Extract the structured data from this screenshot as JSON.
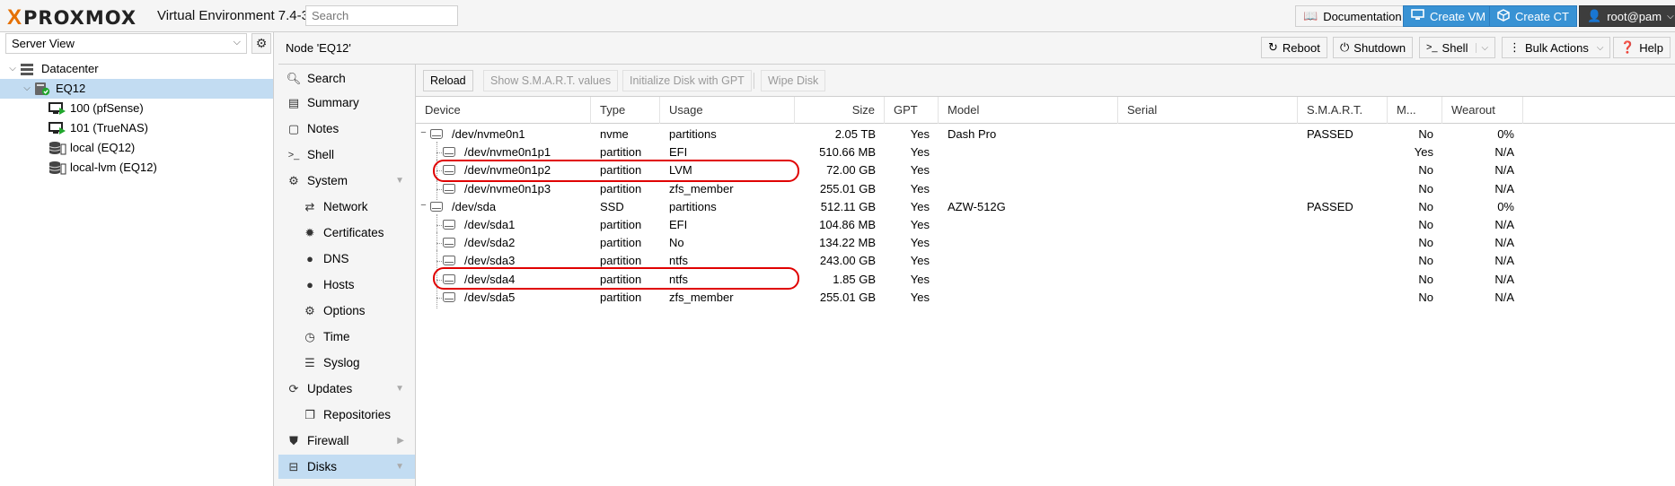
{
  "header": {
    "brand": "PROXMOX",
    "brand_x": "X",
    "version": "Virtual Environment 7.4-3",
    "search_placeholder": "Search",
    "documentation_label": "Documentation",
    "create_vm_label": "Create VM",
    "create_ct_label": "Create CT",
    "user_label": "root@pam"
  },
  "left_panel": {
    "view_select": "Server View",
    "tree": [
      {
        "label": "Datacenter",
        "icon": "datacenter-icon"
      },
      {
        "label": "EQ12",
        "icon": "node-online-icon",
        "selected": true
      },
      {
        "label": "100 (pfSense)",
        "icon": "vm-running-icon"
      },
      {
        "label": "101 (TrueNAS)",
        "icon": "vm-running-icon"
      },
      {
        "label": "local (EQ12)",
        "icon": "storage-icon"
      },
      {
        "label": "local-lvm (EQ12)",
        "icon": "storage-icon"
      }
    ]
  },
  "node_header": {
    "title": "Node 'EQ12'",
    "reboot_label": "Reboot",
    "shutdown_label": "Shutdown",
    "shell_label": "Shell",
    "bulk_actions_label": "Bulk Actions",
    "help_label": "Help"
  },
  "nav": {
    "items": [
      {
        "label": "Search",
        "icon": "search-icon"
      },
      {
        "label": "Summary",
        "icon": "book-icon"
      },
      {
        "label": "Notes",
        "icon": "notes-icon"
      },
      {
        "label": "Shell",
        "icon": "terminal-icon"
      },
      {
        "label": "System",
        "icon": "cogs-icon"
      },
      {
        "label": "Network",
        "icon": "exchange-icon"
      },
      {
        "label": "Certificates",
        "icon": "certificate-icon"
      },
      {
        "label": "DNS",
        "icon": "globe-icon"
      },
      {
        "label": "Hosts",
        "icon": "globe-icon"
      },
      {
        "label": "Options",
        "icon": "gear-icon"
      },
      {
        "label": "Time",
        "icon": "clock-icon"
      },
      {
        "label": "Syslog",
        "icon": "list-icon"
      },
      {
        "label": "Updates",
        "icon": "refresh-icon"
      },
      {
        "label": "Repositories",
        "icon": "files-icon"
      },
      {
        "label": "Firewall",
        "icon": "shield-icon"
      },
      {
        "label": "Disks",
        "icon": "hdd-icon"
      }
    ]
  },
  "toolbar": {
    "reload_label": "Reload",
    "smart_label": "Show S.M.A.R.T. values",
    "init_gpt_label": "Initialize Disk with GPT",
    "wipe_label": "Wipe Disk"
  },
  "disks": {
    "columns": [
      "Device",
      "Type",
      "Usage",
      "Size",
      "GPT",
      "Model",
      "Serial",
      "S.M.A.R.T.",
      "M...",
      "Wearout"
    ],
    "rows": [
      {
        "device": "/dev/nvme0n1",
        "type": "nvme",
        "usage": "partitions",
        "size": "2.05 TB",
        "gpt": "Yes",
        "model": "Dash Pro",
        "serial": "",
        "smart": "PASSED",
        "mounted": "No",
        "wearout": "0%"
      },
      {
        "device": "/dev/nvme0n1p1",
        "type": "partition",
        "usage": "EFI",
        "size": "510.66 MB",
        "gpt": "Yes",
        "model": "",
        "serial": "",
        "smart": "",
        "mounted": "Yes",
        "wearout": "N/A"
      },
      {
        "device": "/dev/nvme0n1p2",
        "type": "partition",
        "usage": "LVM",
        "size": "72.00 GB",
        "gpt": "Yes",
        "model": "",
        "serial": "",
        "smart": "",
        "mounted": "No",
        "wearout": "N/A"
      },
      {
        "device": "/dev/nvme0n1p3",
        "type": "partition",
        "usage": "zfs_member",
        "size": "255.01 GB",
        "gpt": "Yes",
        "model": "",
        "serial": "",
        "smart": "",
        "mounted": "No",
        "wearout": "N/A"
      },
      {
        "device": "/dev/sda",
        "type": "SSD",
        "usage": "partitions",
        "size": "512.11 GB",
        "gpt": "Yes",
        "model": "AZW-512G",
        "serial": "",
        "smart": "PASSED",
        "mounted": "No",
        "wearout": "0%"
      },
      {
        "device": "/dev/sda1",
        "type": "partition",
        "usage": "EFI",
        "size": "104.86 MB",
        "gpt": "Yes",
        "model": "",
        "serial": "",
        "smart": "",
        "mounted": "No",
        "wearout": "N/A"
      },
      {
        "device": "/dev/sda2",
        "type": "partition",
        "usage": "No",
        "size": "134.22 MB",
        "gpt": "Yes",
        "model": "",
        "serial": "",
        "smart": "",
        "mounted": "No",
        "wearout": "N/A"
      },
      {
        "device": "/dev/sda3",
        "type": "partition",
        "usage": "ntfs",
        "size": "243.00 GB",
        "gpt": "Yes",
        "model": "",
        "serial": "",
        "smart": "",
        "mounted": "No",
        "wearout": "N/A"
      },
      {
        "device": "/dev/sda4",
        "type": "partition",
        "usage": "ntfs",
        "size": "1.85 GB",
        "gpt": "Yes",
        "model": "",
        "serial": "",
        "smart": "",
        "mounted": "No",
        "wearout": "N/A"
      },
      {
        "device": "/dev/sda5",
        "type": "partition",
        "usage": "zfs_member",
        "size": "255.01 GB",
        "gpt": "Yes",
        "model": "",
        "serial": "",
        "smart": "",
        "mounted": "No",
        "wearout": "N/A"
      }
    ]
  },
  "colors": {
    "accent_blue": "#3892d4",
    "selection": "#c2dcf2",
    "brand_orange": "#e57000",
    "annotation_red": "#e00000"
  }
}
